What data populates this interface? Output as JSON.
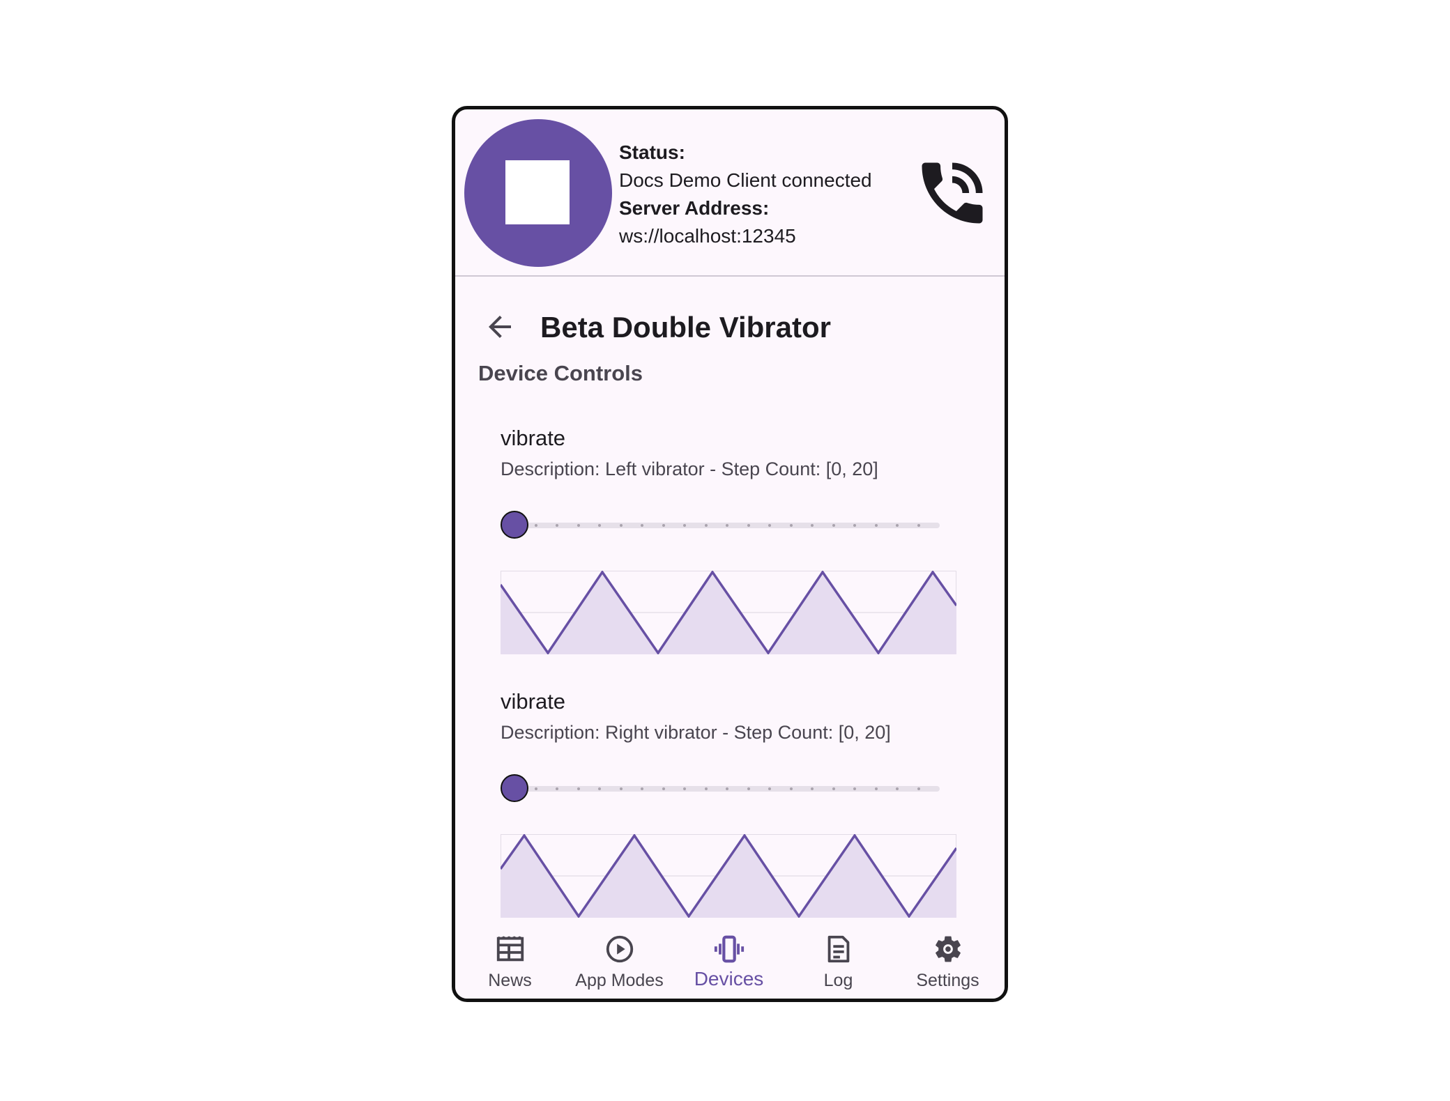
{
  "header": {
    "status_label": "Status:",
    "status_value": "Docs Demo Client connected",
    "server_label": "Server Address:",
    "server_value": "ws://localhost:12345",
    "stop_icon": "stop-icon",
    "phone_icon": "phone-in-talk-icon"
  },
  "page": {
    "title": "Beta Double Vibrator",
    "section_title": "Device Controls"
  },
  "features": [
    {
      "name": "vibrate",
      "description": "Description: Left vibrator - Step Count: [0, 20]",
      "slider_value": 0,
      "slider_max": 20
    },
    {
      "name": "vibrate",
      "description": "Description: Right vibrator - Step Count: [0, 20]",
      "slider_value": 0,
      "slider_max": 20
    }
  ],
  "nav": {
    "items": [
      {
        "label": "News",
        "icon": "newspaper-icon",
        "active": false
      },
      {
        "label": "App Modes",
        "icon": "play-circle-icon",
        "active": false
      },
      {
        "label": "Devices",
        "icon": "vibration-icon",
        "active": true
      },
      {
        "label": "Log",
        "icon": "document-icon",
        "active": false
      },
      {
        "label": "Settings",
        "icon": "gear-icon",
        "active": false
      }
    ]
  },
  "colors": {
    "accent": "#6750a4",
    "background": "#fdf7fd",
    "wave_fill": "#e6dcf0",
    "text_primary": "#1d1b20",
    "text_secondary": "#49454f"
  }
}
